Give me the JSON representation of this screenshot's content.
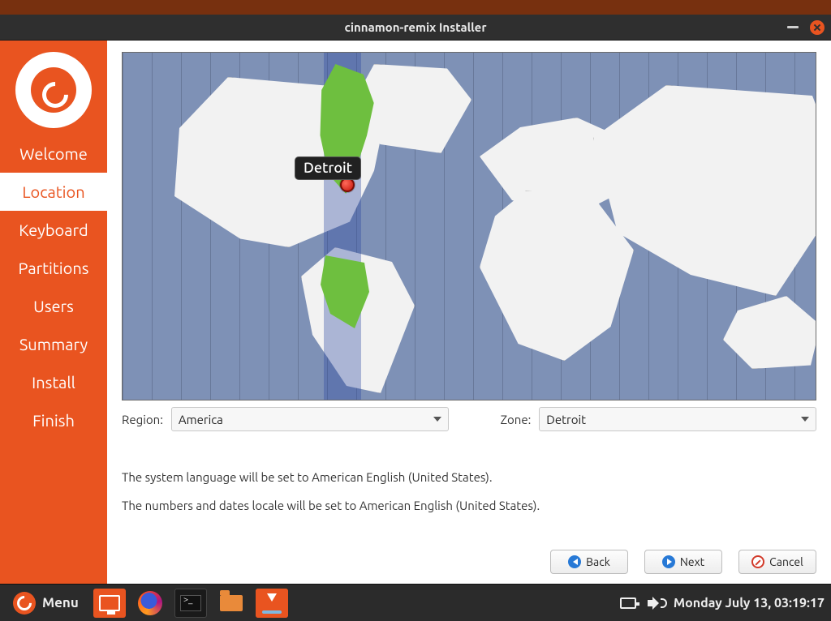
{
  "window": {
    "title": "cinnamon-remix Installer"
  },
  "sidebar": {
    "items": [
      {
        "label": "Welcome",
        "active": false
      },
      {
        "label": "Location",
        "active": true
      },
      {
        "label": "Keyboard",
        "active": false
      },
      {
        "label": "Partitions",
        "active": false
      },
      {
        "label": "Users",
        "active": false
      },
      {
        "label": "Summary",
        "active": false
      },
      {
        "label": "Install",
        "active": false
      },
      {
        "label": "Finish",
        "active": false
      }
    ]
  },
  "map": {
    "marker_label": "Detroit"
  },
  "region": {
    "label": "Region:",
    "value": "America"
  },
  "zone": {
    "label": "Zone:",
    "value": "Detroit"
  },
  "info": {
    "language": "The system language will be set to American English (United States).",
    "locale": "The numbers and dates locale will be set to American English (United States)."
  },
  "buttons": {
    "back": "Back",
    "next": "Next",
    "cancel": "Cancel"
  },
  "taskbar": {
    "menu": "Menu",
    "clock": "Monday July 13, 03:19:17"
  }
}
